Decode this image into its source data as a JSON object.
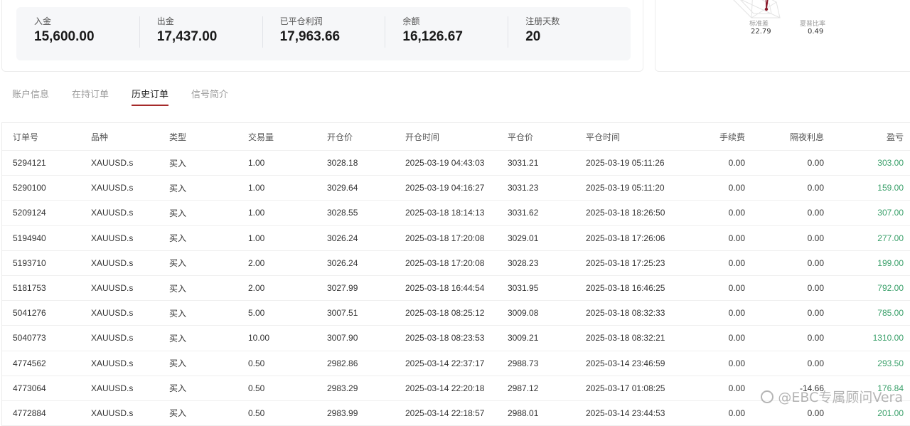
{
  "summary": [
    {
      "label": "入金",
      "value": "15,600.00"
    },
    {
      "label": "出金",
      "value": "17,437.00"
    },
    {
      "label": "已平仓利润",
      "value": "17,963.66"
    },
    {
      "label": "余额",
      "value": "16,126.67"
    },
    {
      "label": "注册天数",
      "value": "20"
    }
  ],
  "radar": {
    "labels": [
      {
        "label": "标准差",
        "value": "22.79"
      },
      {
        "label": "夏普比率",
        "value": "0.49"
      }
    ]
  },
  "tabs": [
    "账户信息",
    "在持订单",
    "历史订单",
    "信号简介"
  ],
  "active_tab": "历史订单",
  "table": {
    "columns": [
      "订单号",
      "品种",
      "类型",
      "交易量",
      "开仓价",
      "开仓时间",
      "平仓价",
      "平仓时间",
      "手续费",
      "隔夜利息",
      "盈亏"
    ],
    "rows": [
      [
        "5294121",
        "XAUUSD.s",
        "买入",
        "1.00",
        "3028.18",
        "2025-03-19 04:43:03",
        "3031.21",
        "2025-03-19 05:11:26",
        "0.00",
        "0.00",
        "303.00"
      ],
      [
        "5290100",
        "XAUUSD.s",
        "买入",
        "1.00",
        "3029.64",
        "2025-03-19 04:16:27",
        "3031.23",
        "2025-03-19 05:11:20",
        "0.00",
        "0.00",
        "159.00"
      ],
      [
        "5209124",
        "XAUUSD.s",
        "买入",
        "1.00",
        "3028.55",
        "2025-03-18 18:14:13",
        "3031.62",
        "2025-03-18 18:26:50",
        "0.00",
        "0.00",
        "307.00"
      ],
      [
        "5194940",
        "XAUUSD.s",
        "买入",
        "1.00",
        "3026.24",
        "2025-03-18 17:20:08",
        "3029.01",
        "2025-03-18 17:26:06",
        "0.00",
        "0.00",
        "277.00"
      ],
      [
        "5193710",
        "XAUUSD.s",
        "买入",
        "2.00",
        "3026.24",
        "2025-03-18 17:20:08",
        "3028.23",
        "2025-03-18 17:25:23",
        "0.00",
        "0.00",
        "199.00"
      ],
      [
        "5181753",
        "XAUUSD.s",
        "买入",
        "2.00",
        "3027.99",
        "2025-03-18 16:44:54",
        "3031.95",
        "2025-03-18 16:46:25",
        "0.00",
        "0.00",
        "792.00"
      ],
      [
        "5041276",
        "XAUUSD.s",
        "买入",
        "5.00",
        "3007.51",
        "2025-03-18 08:25:12",
        "3009.08",
        "2025-03-18 08:32:33",
        "0.00",
        "0.00",
        "785.00"
      ],
      [
        "5040773",
        "XAUUSD.s",
        "买入",
        "10.00",
        "3007.90",
        "2025-03-18 08:23:53",
        "3009.21",
        "2025-03-18 08:32:21",
        "0.00",
        "0.00",
        "1310.00"
      ],
      [
        "4774562",
        "XAUUSD.s",
        "买入",
        "0.50",
        "2982.86",
        "2025-03-14 22:37:17",
        "2988.73",
        "2025-03-14 23:46:59",
        "0.00",
        "0.00",
        "293.50"
      ],
      [
        "4773064",
        "XAUUSD.s",
        "买入",
        "0.50",
        "2983.29",
        "2025-03-14 22:20:18",
        "2987.12",
        "2025-03-17 01:08:25",
        "0.00",
        "-14.66",
        "176.84"
      ],
      [
        "4772884",
        "XAUUSD.s",
        "买入",
        "0.50",
        "2983.99",
        "2025-03-14 22:18:57",
        "2988.01",
        "2025-03-14 23:44:53",
        "0.00",
        "0.00",
        "201.00"
      ]
    ]
  },
  "watermark": "@EBC专属顾问Vera",
  "colors": {
    "accent": "#a52a2a",
    "profit": "#3aa06a",
    "radar_point": "#8b1a2b"
  }
}
